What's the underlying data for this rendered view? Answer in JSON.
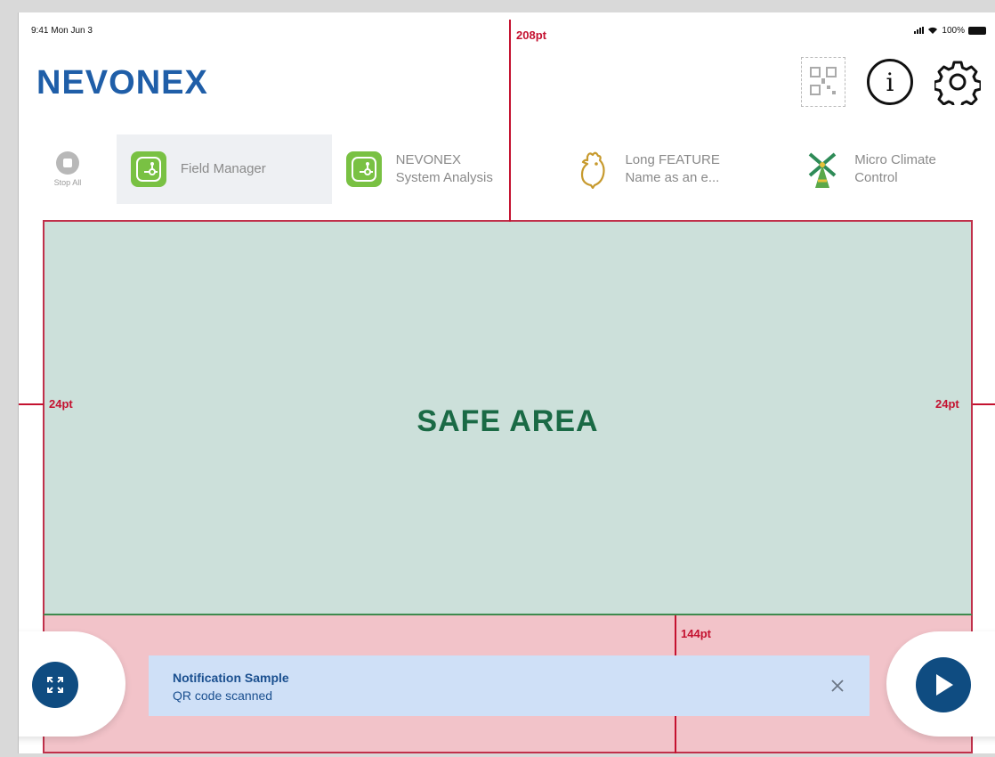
{
  "status_bar": {
    "time_date": "9:41  Mon Jun 3",
    "battery": "100%"
  },
  "app": {
    "logo": "NEVONEX"
  },
  "tabs": {
    "stop_all": "Stop All",
    "items": [
      {
        "label": "Field Manager",
        "active": true,
        "icon": "plant-app-icon"
      },
      {
        "line1": "NEVONEX",
        "line2": "System Analysis",
        "active": false,
        "icon": "plant-app-icon"
      },
      {
        "line1": "Long FEATURE",
        "line2": "Name as an e...",
        "active": false,
        "icon": "chicken-icon"
      },
      {
        "line1": "Micro Climate",
        "line2": "Control",
        "active": false,
        "icon": "windmill-icon"
      }
    ]
  },
  "safe_area": {
    "label": "SAFE AREA"
  },
  "annotations": {
    "top": "208pt",
    "left": "24pt",
    "right": "24pt",
    "bottom": "144pt"
  },
  "notification": {
    "title": "Notification Sample",
    "body": "QR code scanned"
  },
  "colors": {
    "brand": "#1f5ea8",
    "primary_button": "#0f4c81",
    "safe_area": "#cce0da",
    "bottom_zone": "#f2c3c9",
    "measure_line": "#c41230",
    "app_icon": "#79c143"
  }
}
